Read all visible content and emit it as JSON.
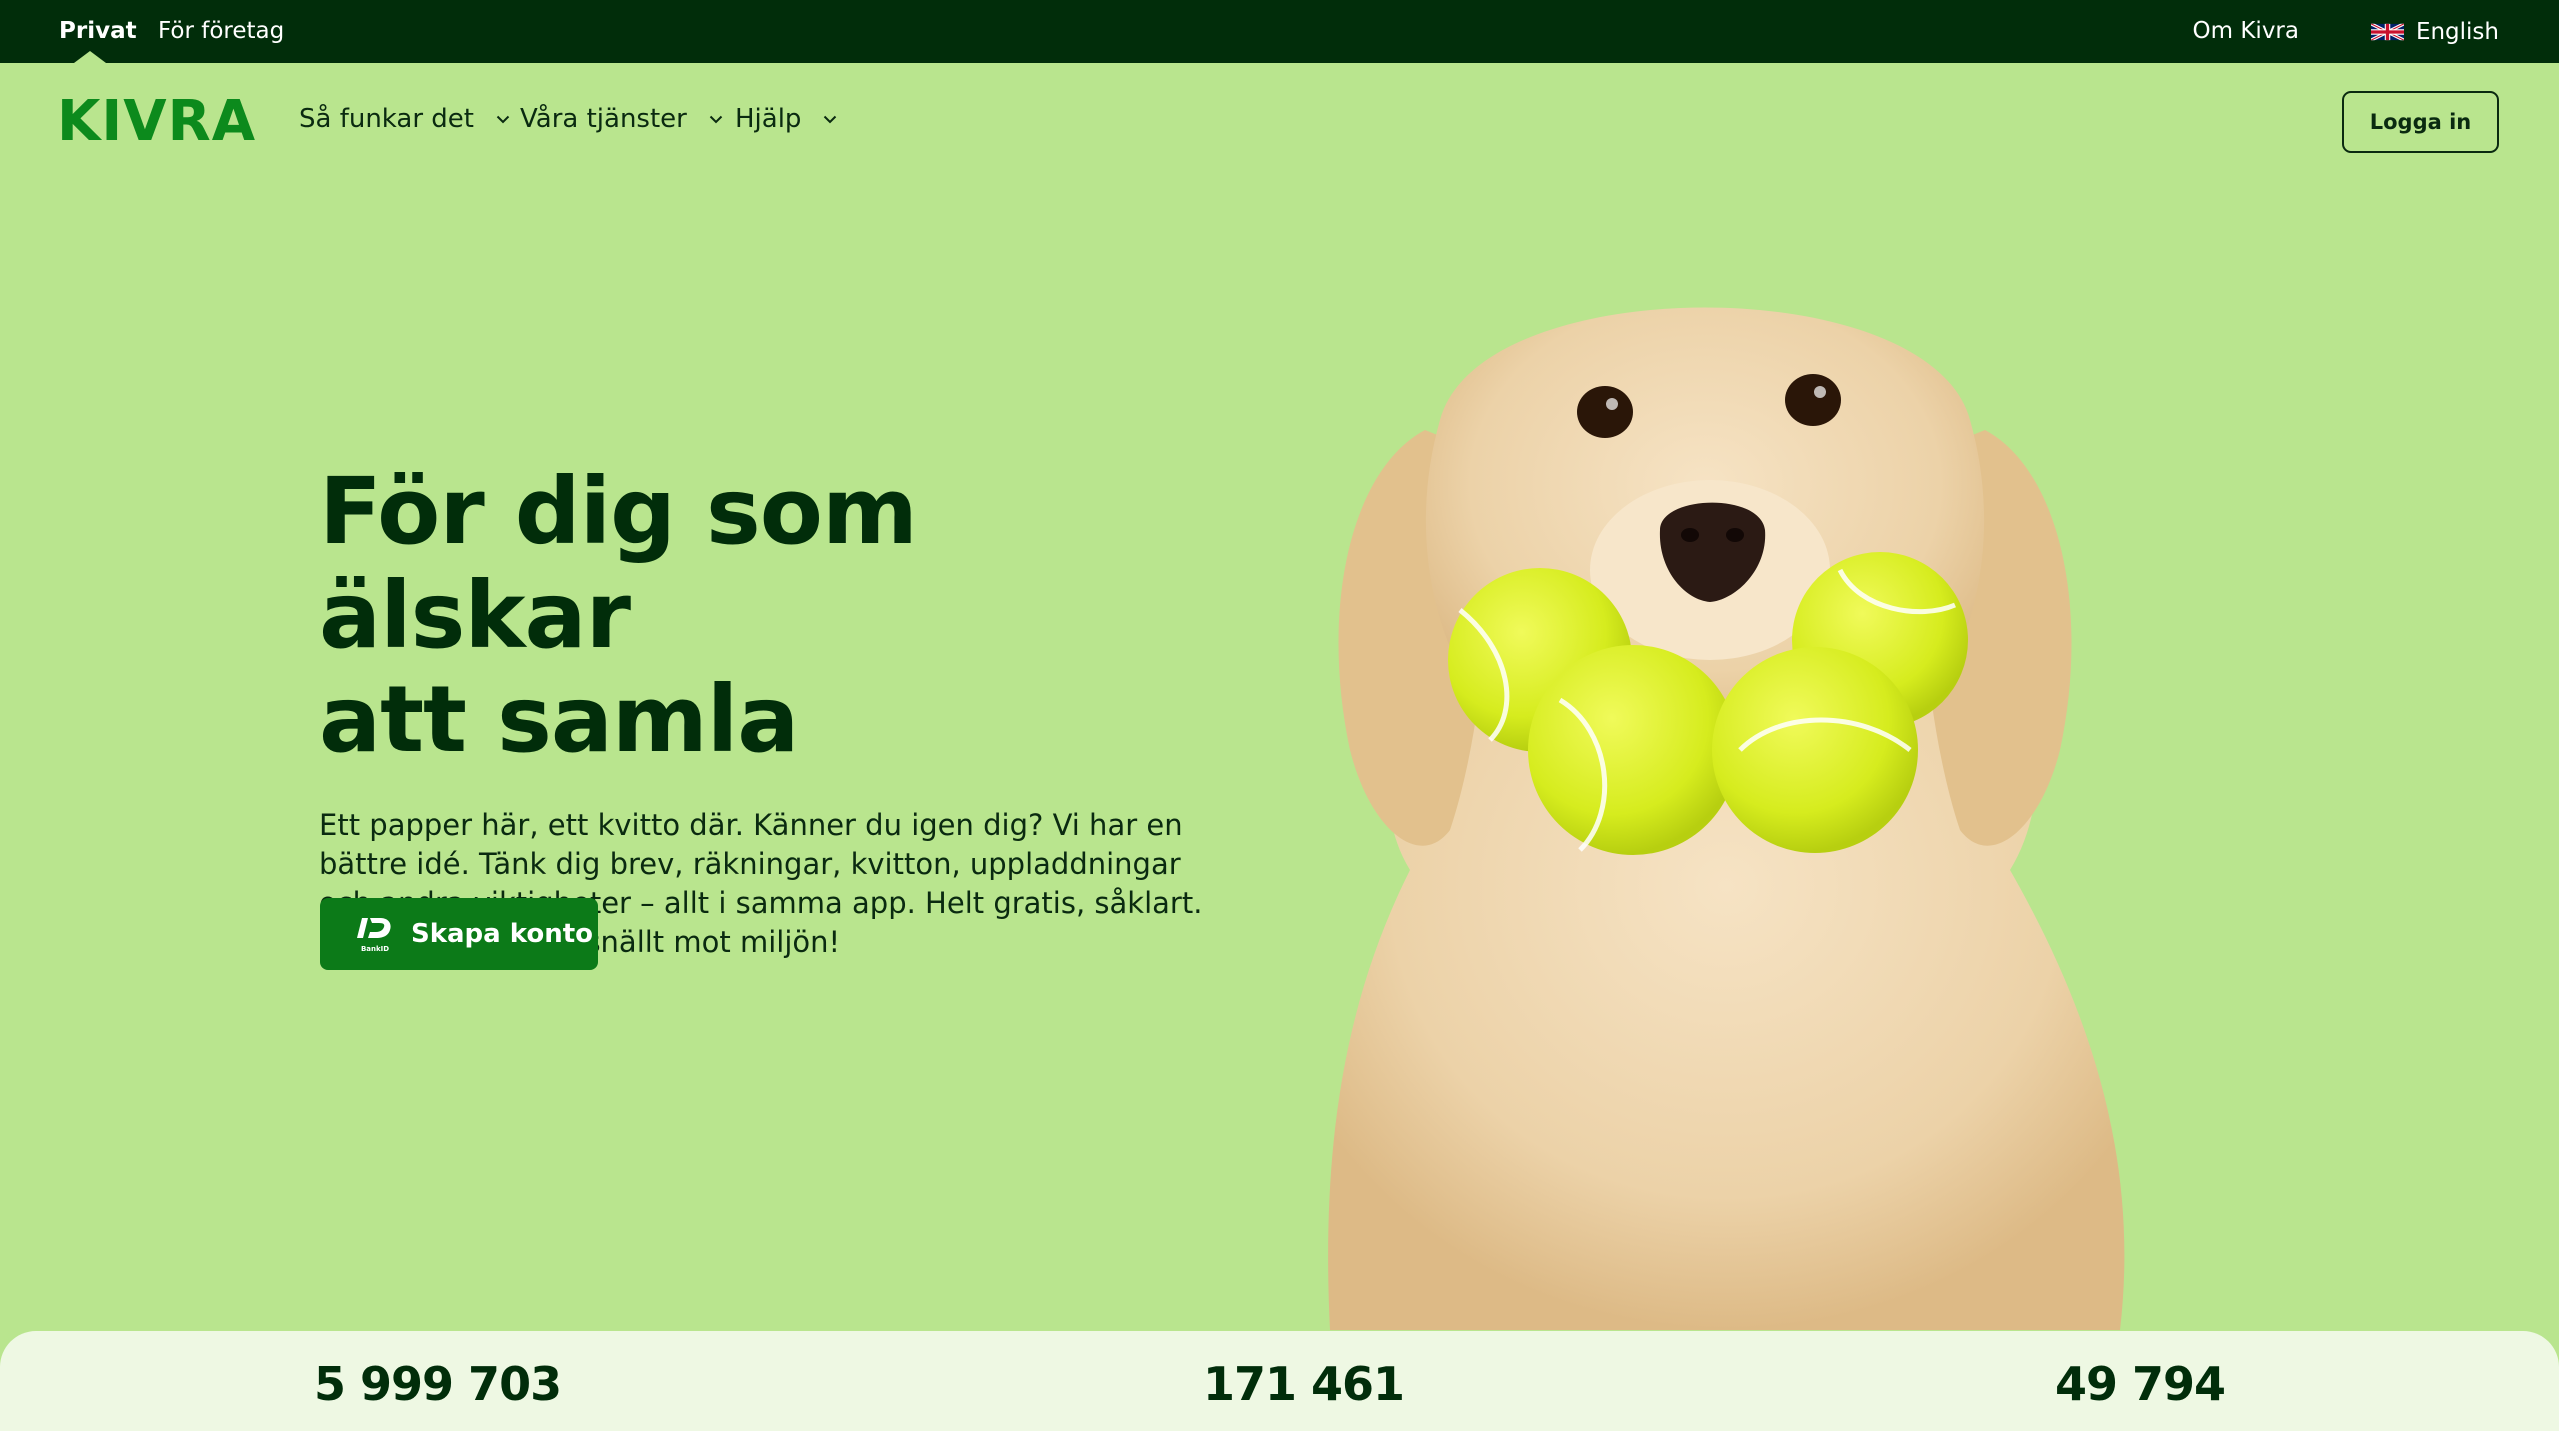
{
  "topbar": {
    "privat": "Privat",
    "foretag": "För företag",
    "om": "Om Kivra",
    "language": "English",
    "language_flag": "uk-flag-icon"
  },
  "nav": {
    "logo": "KIVRA",
    "items": [
      {
        "label": "Så funkar det"
      },
      {
        "label": "Våra tjänster"
      },
      {
        "label": "Hjälp"
      }
    ],
    "login": "Logga in"
  },
  "hero": {
    "headline_line1": "För dig som älskar",
    "headline_line2": "att samla",
    "lead": "Ett papper här, ett kvitto där. Känner du igen dig? Vi har en bättre idé. Tänk dig brev, räkningar, kvitton, uppladdningar och andra viktigheter – allt i samma app. Helt gratis, såklart. Smart, säkert och snällt mot miljön!",
    "cta": "Skapa konto",
    "cta_icon": "bankid-icon"
  },
  "stats": [
    "5 999 703",
    "171 461",
    "49 794"
  ],
  "colors": {
    "background": "#b9e58e",
    "topbar": "#012d0a",
    "brand_green": "#0c8a1c",
    "cta": "#0c7a18",
    "text_dark": "#012d0a",
    "ball": "#dcef2a"
  }
}
